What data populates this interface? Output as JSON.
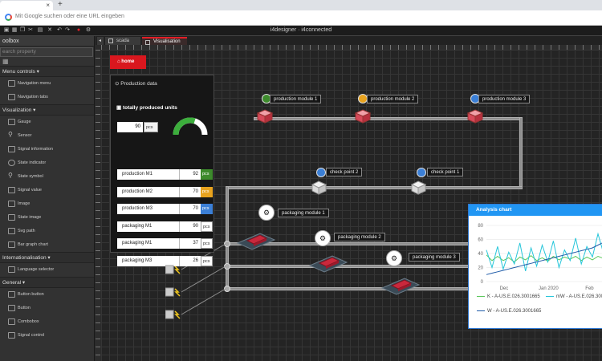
{
  "browser": {
    "address_placeholder": "Mit Google suchen oder eine URL eingeben",
    "new_tab": "+",
    "close_tab": "×"
  },
  "app": {
    "title": "i4designer · i4connected"
  },
  "toolbox": {
    "title": "oolbox",
    "search_placeholder": "earch property",
    "categories": [
      {
        "label": "Menu controls ▾",
        "items": [
          "Navigation menu",
          "Navigation tabs"
        ]
      },
      {
        "label": "Visualization ▾",
        "items": [
          "Gauge",
          "Sensor",
          "Signal information",
          "State indicator",
          "State symbol",
          "Signal value",
          "Image",
          "State image",
          "Svg path",
          "Bar graph chart"
        ]
      },
      {
        "label": "Internationalisation ▾",
        "items": [
          "Language selector"
        ]
      },
      {
        "label": "General ▾",
        "items": [
          "Button button",
          "Button",
          "Combobox",
          "Signal control"
        ]
      }
    ]
  },
  "editor_tabs": [
    {
      "label": "scada",
      "active": false
    },
    {
      "label": "Visualisation",
      "active": true
    }
  ],
  "canvas": {
    "home_label": "home",
    "production_panel": {
      "title": "Production data",
      "subtitle": "totally produced units",
      "total": {
        "value": "90",
        "unit": "pcs",
        "gauge_fraction": 0.6
      },
      "rows": [
        {
          "label": "production M1",
          "value": "92",
          "unit": "pcs",
          "color": "#3d8b2c"
        },
        {
          "label": "production M2",
          "value": "70",
          "unit": "pcs",
          "color": "#e8a31f"
        },
        {
          "label": "production M3",
          "value": "70",
          "unit": "pcs",
          "color": "#3b7fd6"
        },
        {
          "label": "packaging M1",
          "value": "90",
          "unit": "pcs",
          "color": "#ffffff"
        },
        {
          "label": "packaging M1",
          "value": "37",
          "unit": "pcs",
          "color": "#ffffff"
        },
        {
          "label": "packaging M3",
          "value": "26",
          "unit": "pcs",
          "color": "#ffffff"
        }
      ]
    },
    "modules": [
      {
        "label": "production module 1",
        "status_color": "#3d8b2c"
      },
      {
        "label": "production module 2",
        "status_color": "#e8a31f"
      },
      {
        "label": "production module 3",
        "status_color": "#3b7fd6"
      }
    ],
    "checkpoints": [
      {
        "label": "check point 2",
        "status_color": "#3b7fd6"
      },
      {
        "label": "check point 1",
        "status_color": "#3b7fd6"
      }
    ],
    "packaging_modules": [
      "packaging module 1",
      "packaging module 2",
      "packaging module 3"
    ]
  },
  "chart_panel": {
    "title": "Analysis chart"
  },
  "chart_data": {
    "type": "line",
    "ylim": [
      0,
      80
    ],
    "yticks": [
      0,
      20,
      40,
      60,
      80
    ],
    "xticks": [
      "Dec",
      "Jan 2020",
      "Feb"
    ],
    "series": [
      {
        "name": "K - A-US.E.026.3001665",
        "color": "#5bc85b",
        "values": [
          38,
          30,
          36,
          30,
          34,
          28,
          35,
          31,
          37,
          30,
          34,
          29,
          36,
          31,
          35,
          32,
          36,
          30,
          35,
          31,
          36,
          33
        ]
      },
      {
        "name": "mW - A-US.E.026.300",
        "color": "#26c6da",
        "values": [
          45,
          20,
          50,
          18,
          42,
          25,
          55,
          15,
          48,
          22,
          52,
          28,
          58,
          20,
          45,
          30,
          62,
          25,
          50,
          35,
          68,
          40
        ]
      },
      {
        "name": "W - A-US.E.026.3001665",
        "color": "#1e5aa8",
        "values": [
          10,
          12,
          14,
          16,
          18,
          20,
          22,
          24,
          26,
          28,
          30,
          32,
          34,
          36,
          38,
          40,
          42,
          44,
          46,
          48,
          52,
          56
        ]
      }
    ]
  },
  "colors": {
    "accent_red": "#d9171e",
    "chart_header": "#2196f3"
  }
}
